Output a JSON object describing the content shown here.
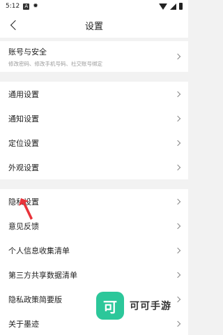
{
  "status_bar": {
    "time": "5:12",
    "icons": [
      "a-box-icon",
      "gear-icon",
      "wifi-icon",
      "signal-icon",
      "battery-icon"
    ]
  },
  "nav": {
    "title": "设置"
  },
  "account": {
    "title": "账号与安全",
    "subtitle": "修改密码、修改手机号码、社交账号绑定"
  },
  "group_general": {
    "items": [
      {
        "label": "通用设置"
      },
      {
        "label": "通知设置"
      },
      {
        "label": "定位设置"
      },
      {
        "label": "外观设置"
      }
    ]
  },
  "group_privacy": {
    "items": [
      {
        "label": "隐私设置"
      },
      {
        "label": "意见反馈"
      },
      {
        "label": "个人信息收集清单"
      },
      {
        "label": "第三方共享数据清单"
      },
      {
        "label": "隐私政策简要版"
      },
      {
        "label": "关于墨迹"
      }
    ]
  },
  "watermark": {
    "logo_char": "可",
    "text": "可可手游",
    "color": "#2cc79a"
  },
  "annotation": {
    "arrow_color": "#e8333a"
  }
}
